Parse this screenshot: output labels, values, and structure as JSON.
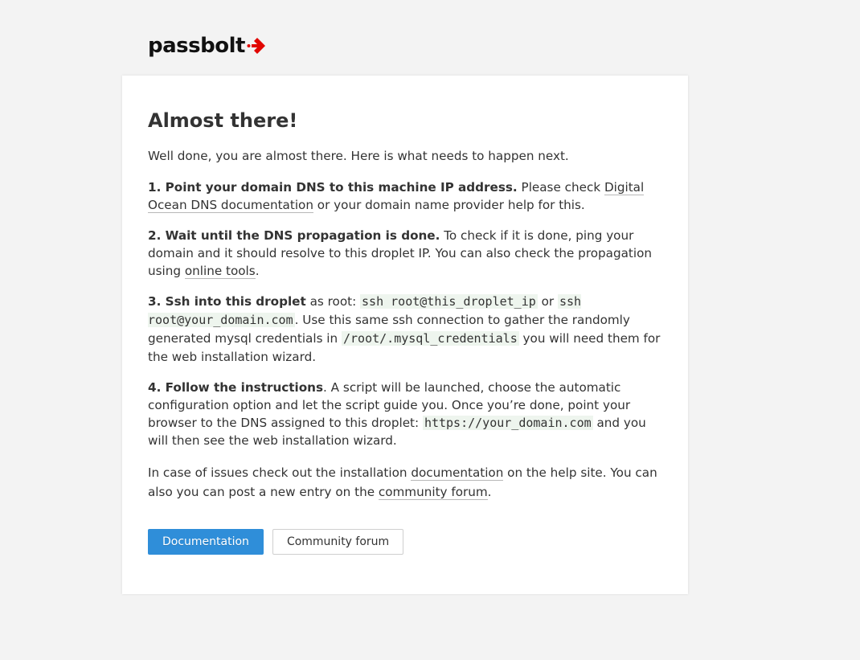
{
  "brand": {
    "logo_text": "passbolt",
    "accent_color": "#e10600"
  },
  "card": {
    "title": "Almost there!",
    "intro": "Well done, you are almost there. Here is what needs to happen next.",
    "step1": {
      "heading": "1. Point your domain DNS to this machine IP address.",
      "text_a": " Please check ",
      "link": "Digital Ocean DNS documentation",
      "text_b": " or your domain name provider help for this."
    },
    "step2": {
      "heading": "2. Wait until the DNS propagation is done.",
      "text_a": " To check if it is done, ping your domain and it should resolve to this droplet IP. You can also check the propagation using ",
      "link": "online tools",
      "text_b": "."
    },
    "step3": {
      "heading": "3. Ssh into this droplet",
      "text_a": " as root: ",
      "code1": "ssh root@this_droplet_ip",
      "text_b": " or ",
      "code2": "ssh root@your_domain.com",
      "text_c": ". Use this same ssh connection to gather the randomly generated mysql credentials in ",
      "code3": "/root/.mysql_credentials",
      "text_d": " you will need them for the web installation wizard."
    },
    "step4": {
      "heading": "4. Follow the instructions",
      "text_a": ". A script will be launched, choose the automatic configuration option and let the script guide you. Once you’re done, point your browser to the DNS assigned to this droplet: ",
      "code1": "https://your_domain.com",
      "text_b": " and you will then see the web installation wizard."
    },
    "help": {
      "text_a": "In case of issues check out the installation ",
      "link1": "documentation",
      "text_b": " on the help site. You can also you can post a new entry on the ",
      "link2": "community forum",
      "text_c": "."
    },
    "buttons": {
      "documentation": "Documentation",
      "community_forum": "Community forum"
    }
  }
}
